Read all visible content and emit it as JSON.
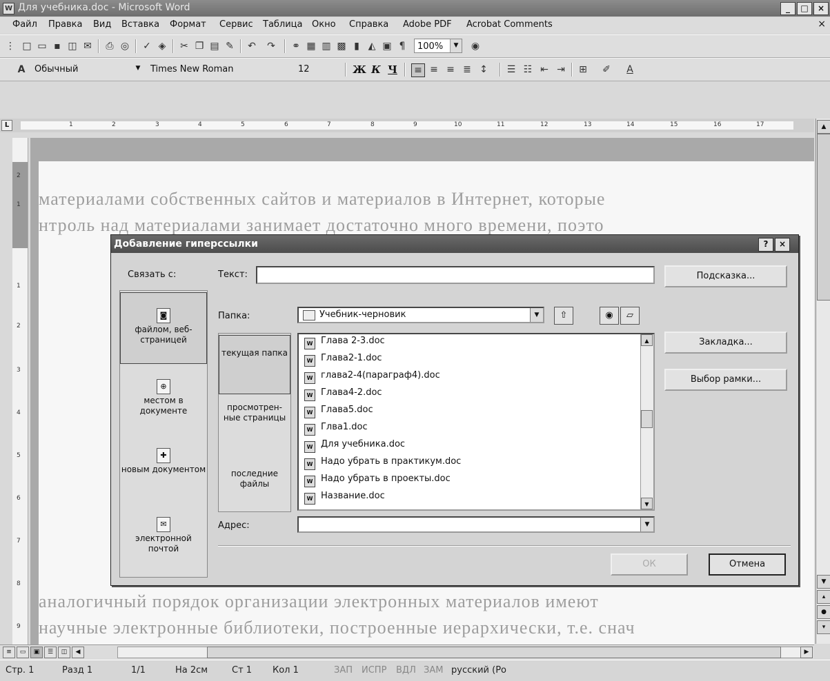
{
  "window": {
    "title": "Для учебника.doc - Microsoft Word",
    "app_icon": "W",
    "controls": [
      "_",
      "□",
      "×"
    ]
  },
  "menu": {
    "items": [
      "Файл",
      "Правка",
      "Вид",
      "Вставка",
      "Формат",
      "Сервис",
      "Таблица",
      "Окно",
      "Справка",
      "Adobe PDF",
      "Acrobat Comments"
    ],
    "close": "×"
  },
  "toolbar_standard": {
    "zoom": "100%",
    "pilcrow": "¶"
  },
  "toolbar_format": {
    "style": "Обычный",
    "font": "Times New Roman",
    "size": "12",
    "bold": "Ж",
    "italic": "К",
    "underline": "Ч"
  },
  "ruler": {
    "corner": "L",
    "marks": [
      "1",
      "2",
      "3",
      "4",
      "5",
      "6",
      "7",
      "8",
      "9",
      "10",
      "11",
      "12",
      "13",
      "14",
      "15",
      "16",
      "17"
    ]
  },
  "vruler": {
    "marks": [
      "2",
      "1",
      "1",
      "2",
      "3",
      "4",
      "5",
      "6",
      "7",
      "8",
      "9"
    ]
  },
  "document_lines": [
    "материалами собственных сайтов и материалов в Интернет, которые",
    "нтроль над материалами занимает достаточно много времени, поэто",
    "",
    "",
    "",
    "",
    "",
    "",
    "",
    "",
    "",
    "",
    "аналогичный порядок организации электронных материалов имеют",
    "научные электронные библиотеки, построенные иерархически, т.е. снач"
  ],
  "dialog": {
    "title": "Добавление гиперссылки",
    "help": "?",
    "close": "×",
    "link_to_label": "Связать с:",
    "link_to": [
      {
        "label": "файлом, веб-страницей",
        "icon": "file-web-icon",
        "glyph": "◙"
      },
      {
        "label": "местом в документе",
        "icon": "place-in-document-icon",
        "glyph": "⊕"
      },
      {
        "label": "новым документом",
        "icon": "new-document-icon",
        "glyph": "✚"
      },
      {
        "label": "электронной почтой",
        "icon": "email-icon",
        "glyph": "✉"
      }
    ],
    "text_label": "Текст:",
    "text_value": "",
    "tip_button": "Подсказка...",
    "folder_label": "Папка:",
    "folder_value": "Учебник-черновик",
    "places": [
      "текущая папка",
      "просмотрен-ные страницы",
      "последние файлы"
    ],
    "files": [
      "Глава 2-3.doc",
      "Глава2-1.doc",
      "глава2-4(параграф4).doc",
      "Глава4-2.doc",
      "Глава5.doc",
      "Глва1.doc",
      "Для учебника.doc",
      "Надо убрать в практикум.doc",
      "Надо убрать в проекты.doc",
      "Название.doc"
    ],
    "bookmark_button": "Закладка...",
    "frame_button": "Выбор рамки...",
    "address_label": "Адрес:",
    "address_value": "",
    "ok_button": "ОК",
    "cancel_button": "Отмена"
  },
  "status": {
    "page": "Стр. 1",
    "section": "Разд 1",
    "pages": "1/1",
    "at": "На 2см",
    "line": "Ст 1",
    "col": "Кол 1",
    "rec": "ЗАП",
    "trk": "ИСПР",
    "ext": "ВДЛ",
    "ovr": "ЗАМ",
    "language": "русский (Ро"
  }
}
